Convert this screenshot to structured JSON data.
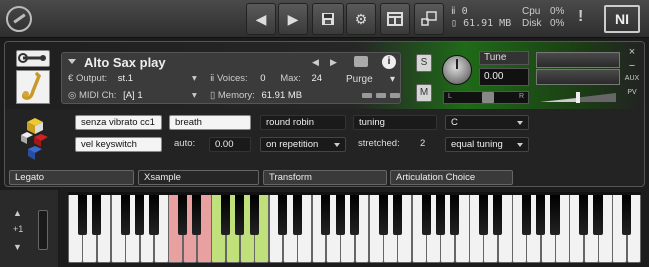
{
  "toolbar": {
    "memory_voices": "0",
    "memory_size": "61.91 MB",
    "cpu_label": "Cpu",
    "cpu_value": "0%",
    "disk_label": "Disk",
    "disk_value": "0%",
    "alert": "!",
    "ni_logo": "NI",
    "icons": [
      "kontakt-logo-icon",
      "prev-arrow-icon",
      "next-arrow-icon",
      "save-icon",
      "gear-icon",
      "layout-icon",
      "minimize-icon"
    ]
  },
  "instrument": {
    "name": "Alto Sax play",
    "output_label": "Output:",
    "output_value": "st.1",
    "voices_label": "Voices:",
    "voices_value": "0",
    "max_label": "Max:",
    "max_value": "24",
    "midi_label": "MIDI Ch:",
    "midi_value": "[A]  1",
    "memory_label": "Memory:",
    "memory_value": "61.91 MB",
    "purge_label": "Purge",
    "solo": "S",
    "mute": "M",
    "tune_label": "Tune",
    "tune_value": "0.00",
    "pan_left": "L",
    "pan_right": "R",
    "close": "×",
    "minus": "−",
    "aux": "AUX",
    "pv": "PV"
  },
  "performance": {
    "row1": {
      "articulation": "senza vibrato cc1",
      "breath": "breath",
      "round_robin": "round robin",
      "tuning": "tuning",
      "key": "C"
    },
    "row2": {
      "vel_keyswitch": "vel keyswitch",
      "auto_label": "auto:",
      "auto_value": "0.00",
      "repetition": "on repetition",
      "stretched_label": "stretched:",
      "stretched_value": "2",
      "temperament": "equal tuning"
    }
  },
  "tabs": [
    "Legato",
    "Xsample",
    "Transform",
    "Articulation Choice"
  ],
  "keyboard": {
    "octave_shift": "+1",
    "red_keys_range": "C1–E1",
    "green_keys_range": "F1–B1"
  },
  "colors": {
    "green_accent": "#2a8a1e",
    "red_key": "#e8a0a0",
    "green_key": "#bfe07a"
  }
}
